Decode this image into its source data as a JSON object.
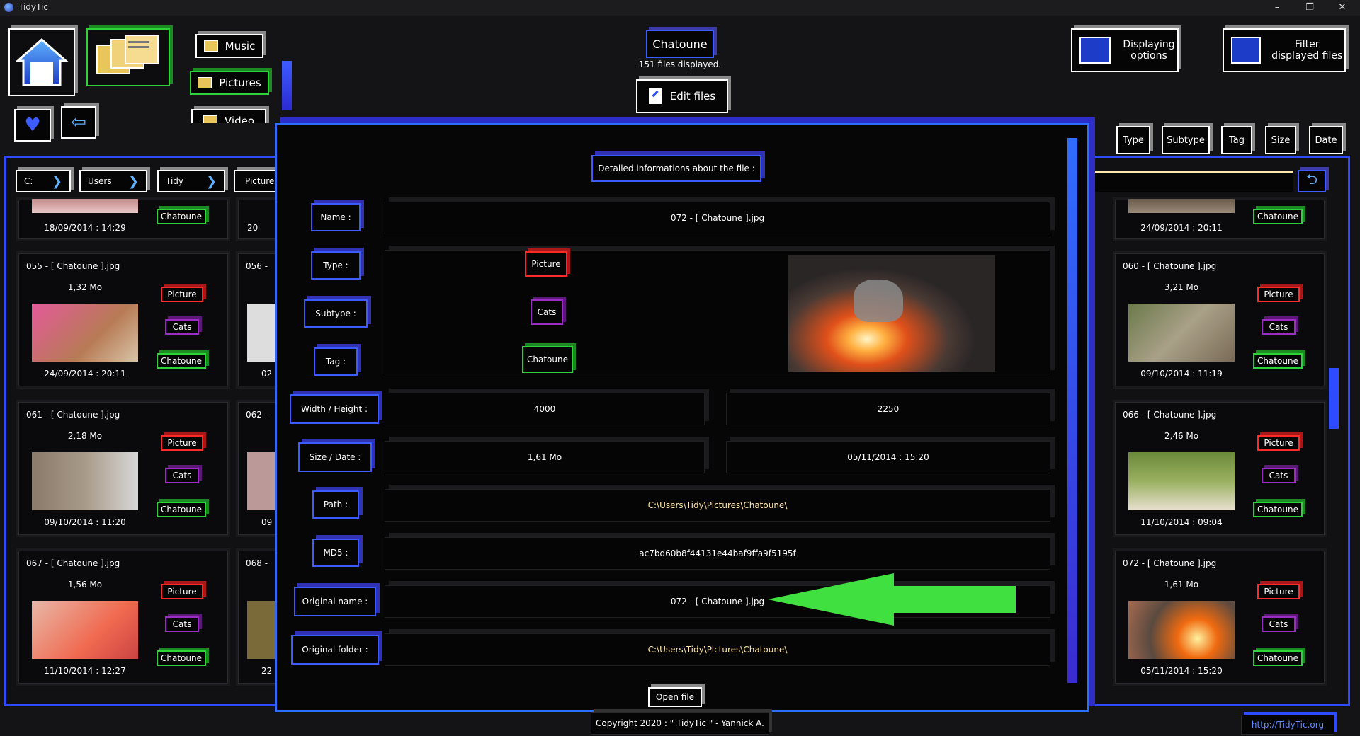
{
  "window": {
    "title": "TidyTic",
    "minimize": "–",
    "restore": "❐",
    "close": "✕"
  },
  "nav": {
    "music": "Music",
    "pictures": "Pictures",
    "videos": "Video"
  },
  "header": {
    "folder": "Chatoune",
    "files_displayed": "151 files displayed.",
    "edit_files": "Edit files"
  },
  "top_right": {
    "displaying_options": "Displaying options",
    "filter_displayed_files": "Filter displayed files"
  },
  "sort_buttons": [
    "Type",
    "Subtype",
    "Tag",
    "Size",
    "Date"
  ],
  "breadcrumb": [
    "C:",
    "Users",
    "Tidy",
    "Pictures"
  ],
  "tags": {
    "type": "Picture",
    "subtype": "Cats",
    "tag": "Chatoune"
  },
  "left_cards": [
    {
      "name": "",
      "size": "",
      "date": "18/09/2014 : 14:29"
    },
    {
      "name": "055 - [ Chatoune ].jpg",
      "size": "1,32 Mo",
      "date": "24/09/2014 : 20:11"
    },
    {
      "name": "061 - [ Chatoune ].jpg",
      "size": "2,18 Mo",
      "date": "09/10/2014 : 11:20"
    },
    {
      "name": "067 - [ Chatoune ].jpg",
      "size": "1,56 Mo",
      "date": "11/10/2014 : 12:27"
    }
  ],
  "mid_cards": [
    {
      "name": "",
      "date": "20"
    },
    {
      "name": "056 -",
      "date": "02"
    },
    {
      "name": "062 -",
      "date": "09"
    },
    {
      "name": "068 -",
      "date": "22"
    }
  ],
  "right_cards": [
    {
      "name": "",
      "size": "",
      "date": "24/09/2014 : 20:11"
    },
    {
      "name": "060 - [ Chatoune ].jpg",
      "size": "3,21 Mo",
      "date": "09/10/2014 : 11:19"
    },
    {
      "name": "066 - [ Chatoune ].jpg",
      "size": "2,46 Mo",
      "date": "11/10/2014 : 09:04"
    },
    {
      "name": "072 - [ Chatoune ].jpg",
      "size": "1,61 Mo",
      "date": "05/11/2014 : 15:20"
    }
  ],
  "details": {
    "heading": "Detailed informations about the file :",
    "labels": {
      "name": "Name :",
      "type": "Type :",
      "subtype": "Subtype :",
      "tag": "Tag :",
      "width_height": "Width / Height :",
      "size_date": "Size / Date :",
      "path": "Path :",
      "md5": "MD5 :",
      "original_name": "Original name :",
      "original_folder": "Original folder :"
    },
    "values": {
      "name": "072 - [ Chatoune ].jpg",
      "type": "Picture",
      "subtype": "Cats",
      "tag": "Chatoune",
      "width": "4000",
      "height": "2250",
      "size": "1,61 Mo",
      "date": "05/11/2014 : 15:20",
      "path": "C:\\Users\\Tidy\\Pictures\\Chatoune\\",
      "md5": "ac7bd60b8f44131e44baf9ffa9f5195f",
      "original_name": "072 - [ Chatoune ].jpg",
      "original_folder": "C:\\Users\\Tidy\\Pictures\\Chatoune\\"
    },
    "open_file": "Open file"
  },
  "footer": {
    "copyright": "Copyright 2020 : \" TidyTic \" - Yannick A.",
    "link": "http://TidyTic.org"
  },
  "colors": {
    "accent_blue": "#3d5cff",
    "picture_red": "#ff2b2b",
    "cats_purple": "#9b2dc4",
    "tag_green": "#2ed33a",
    "arrow_green": "#3fe03f"
  }
}
